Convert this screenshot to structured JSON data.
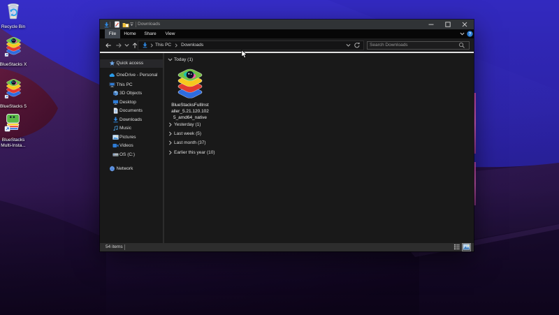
{
  "desktop": {
    "icons": [
      {
        "icon": "recycle-bin-icon",
        "label_lines": [
          "Recycle Bin"
        ]
      },
      {
        "icon": "bluestacks-x-icon",
        "label_lines": [
          "BlueStacks X"
        ]
      },
      {
        "icon": "bluestacks-5-icon",
        "label_lines": [
          "BlueStacks 5"
        ]
      },
      {
        "icon": "bluestacks-multi-icon",
        "label_lines": [
          "BlueStacks",
          "Multi-Insta..."
        ]
      }
    ]
  },
  "window": {
    "title": "Downloads",
    "quick_access_toolbar": {
      "icons": [
        "downloads-arrow-icon",
        "properties-icon",
        "new-folder-icon",
        "qat-chevron-icon"
      ]
    },
    "caption_buttons": [
      "minimize",
      "maximize",
      "close"
    ],
    "ribbon": {
      "tabs": [
        {
          "label": "File",
          "active": true
        },
        {
          "label": "Home",
          "active": false
        },
        {
          "label": "Share",
          "active": false
        },
        {
          "label": "View",
          "active": false
        }
      ],
      "expand_icon": "chevron-down-icon",
      "help_icon": "help-icon"
    },
    "address": {
      "icon": "downloads-arrow-icon",
      "crumbs": [
        "This PC",
        "Downloads"
      ]
    },
    "search": {
      "placeholder": "Search Downloads"
    },
    "sidebar": [
      {
        "label": "Quick access",
        "icon": "star-icon",
        "level": 0
      },
      {
        "label": "OneDrive - Personal",
        "icon": "cloud-icon",
        "level": 0
      },
      {
        "label": "This PC",
        "icon": "computer-icon",
        "level": 0
      },
      {
        "label": "3D Objects",
        "icon": "cube-icon",
        "level": 1
      },
      {
        "label": "Desktop",
        "icon": "monitor-icon",
        "level": 1
      },
      {
        "label": "Documents",
        "icon": "document-icon",
        "level": 1
      },
      {
        "label": "Downloads",
        "icon": "download-icon",
        "level": 1
      },
      {
        "label": "Music",
        "icon": "music-icon",
        "level": 1
      },
      {
        "label": "Pictures",
        "icon": "picture-icon",
        "level": 1
      },
      {
        "label": "Videos",
        "icon": "video-icon",
        "level": 1
      },
      {
        "label": "OS (C:)",
        "icon": "drive-icon",
        "level": 1
      },
      {
        "label": "Network",
        "icon": "network-icon",
        "level": 0
      }
    ],
    "content": {
      "groups": [
        {
          "label": "Today (1)",
          "expanded": true
        },
        {
          "label": "Yesterday (1)",
          "expanded": false
        },
        {
          "label": "Last week (5)",
          "expanded": false
        },
        {
          "label": "Last month (37)",
          "expanded": false
        },
        {
          "label": "Earlier this year (10)",
          "expanded": false
        }
      ],
      "file": {
        "icon": "bluestacks-installer-icon",
        "name_lines": [
          "BlueStacksFullInst",
          "aller_5.21.120.102",
          "5_amd64_native"
        ]
      }
    },
    "statusbar": {
      "items_text": "54 items",
      "view_toggles": [
        "details-view-icon",
        "thumbnail-view-icon"
      ],
      "selected_view": "thumbnail-view-icon"
    }
  },
  "colors": {
    "wallpaper_blue": "#3a31d8",
    "wallpaper_purple": "#4b2180",
    "wallpaper_maroon": "#772044",
    "wallpaper_pink_edge": "#f055c8",
    "titlebar": "#303336",
    "ribbon_bg": "#070707",
    "active_tab_bg": "#40464e",
    "pane_bg": "#191919",
    "statusbar_bg": "#2d2d2d",
    "accent_blue": "#2f8be6"
  }
}
